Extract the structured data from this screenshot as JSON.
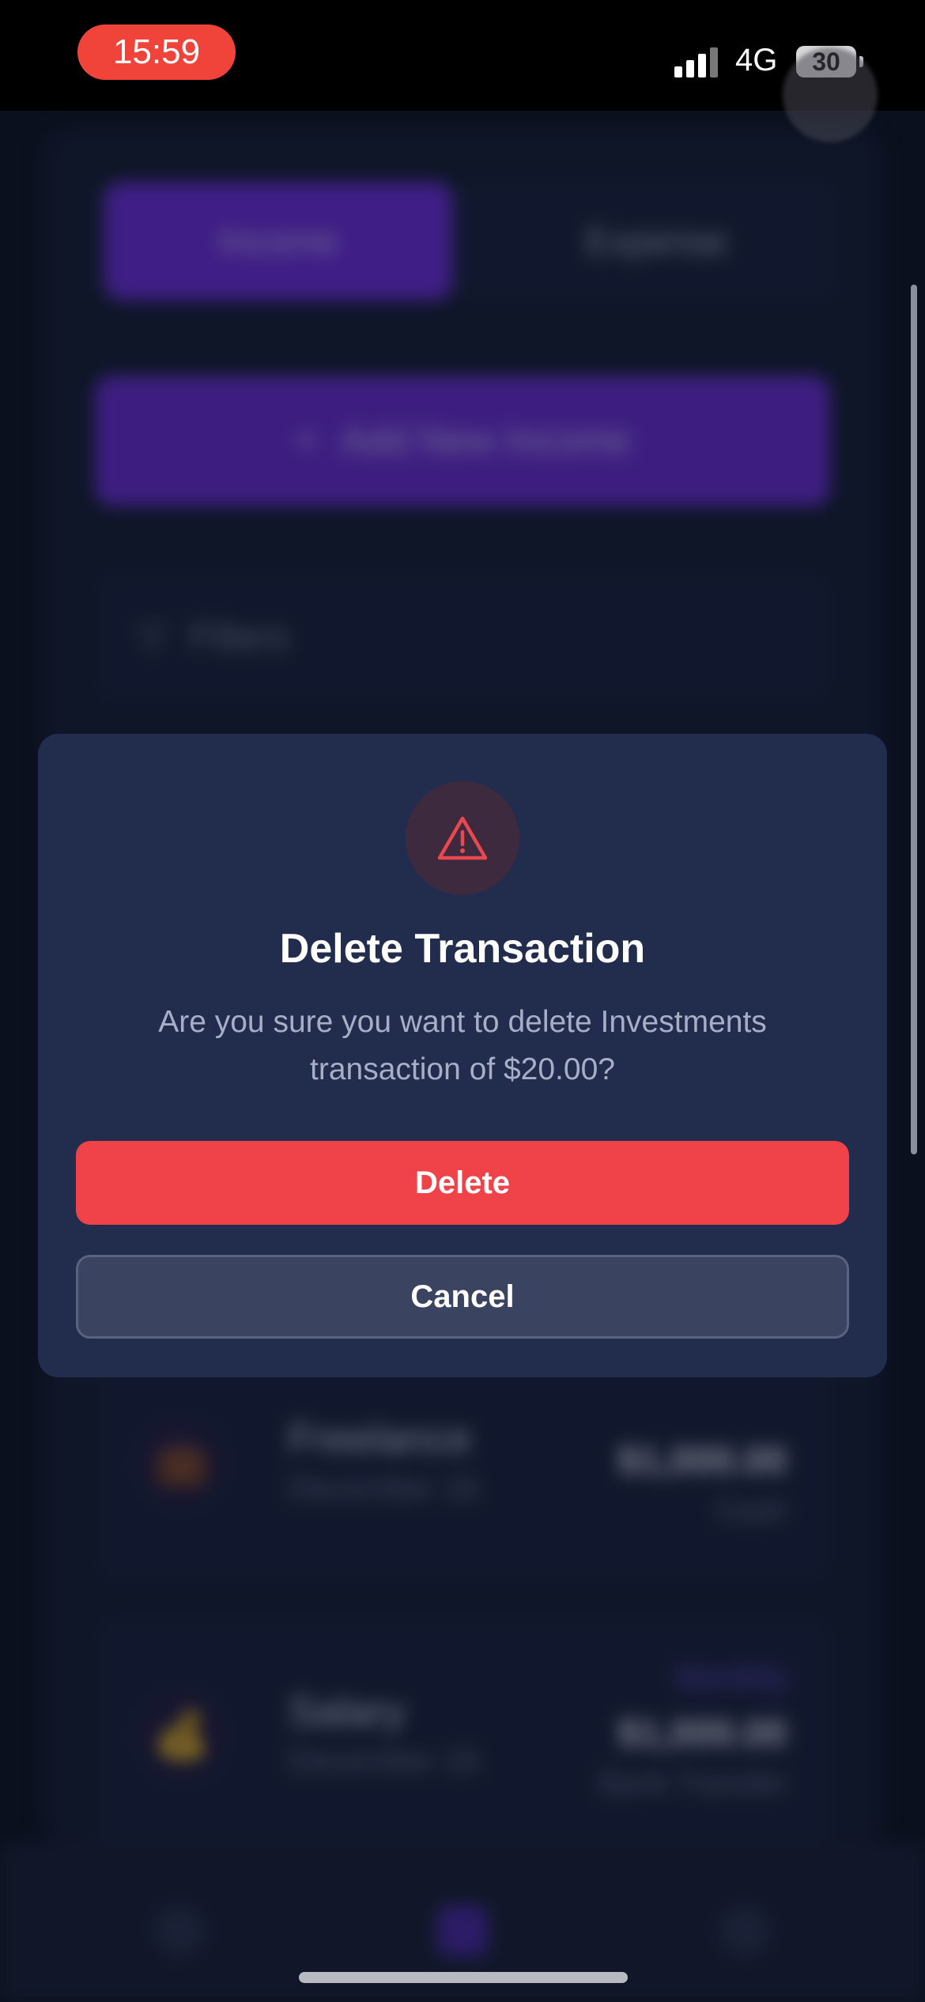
{
  "status_bar": {
    "time": "15:59",
    "network": "4G",
    "battery": "30"
  },
  "background": {
    "segments": [
      "Income",
      "Expense"
    ],
    "add_button_label": "Add New Income",
    "filters_label": "Filters",
    "transactions": [
      {
        "name": "Freelance",
        "date": "December 16",
        "amount": "$1,000.00",
        "method": "Cash",
        "frequency": ""
      },
      {
        "name": "Salary",
        "date": "December 16",
        "amount": "$1,000.00",
        "method": "Bank Transfer",
        "frequency": "Monthly"
      }
    ]
  },
  "dialog": {
    "icon": "warning-triangle-icon",
    "title": "Delete Transaction",
    "message": "Are you sure you want to delete Investments transaction of $20.00?",
    "confirm_label": "Delete",
    "cancel_label": "Cancel"
  },
  "colors": {
    "danger": "#ef4349",
    "accent": "#6d2fe0",
    "dialog_bg": "#222d4d"
  }
}
